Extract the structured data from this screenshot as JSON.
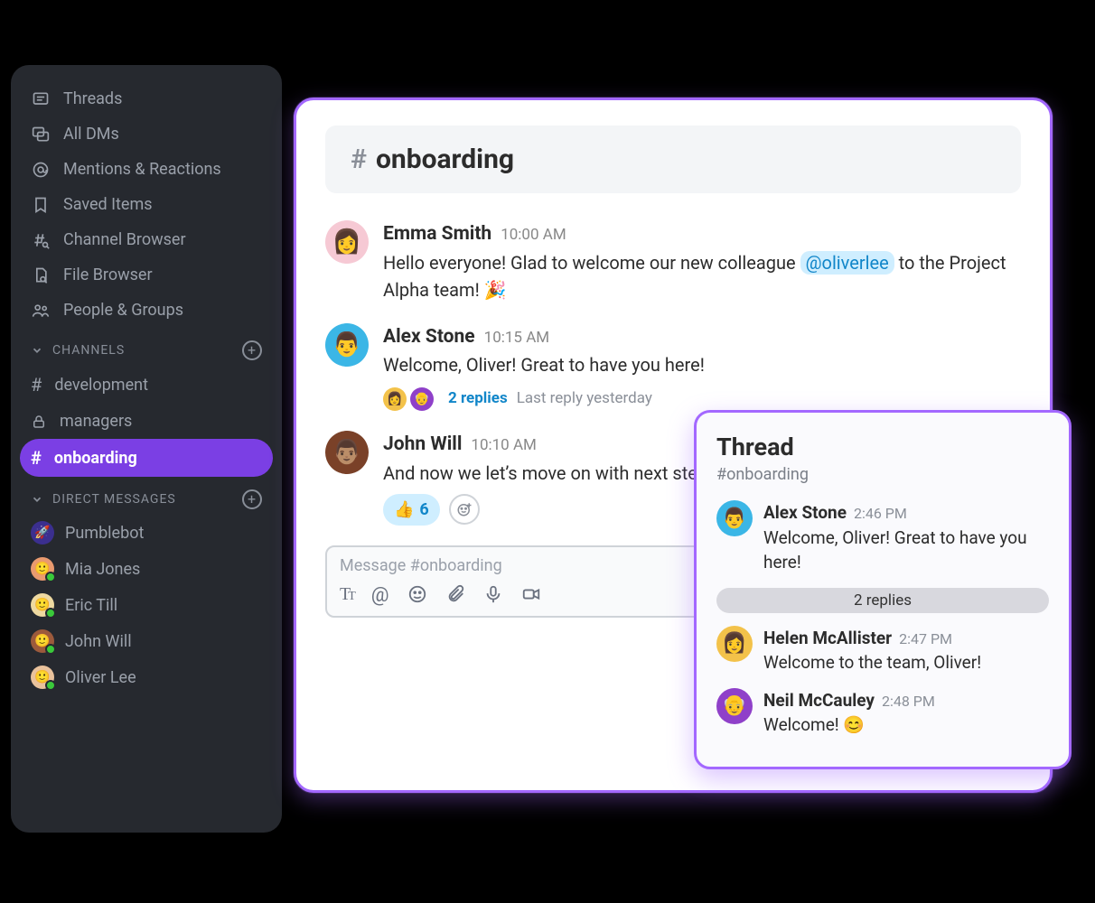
{
  "sidebar": {
    "items": [
      {
        "label": "Threads",
        "icon": "threads-icon"
      },
      {
        "label": "All DMs",
        "icon": "dms-icon"
      },
      {
        "label": "Mentions & Reactions",
        "icon": "mention-icon"
      },
      {
        "label": "Saved Items",
        "icon": "bookmark-icon"
      },
      {
        "label": "Channel Browser",
        "icon": "hash-search-icon"
      },
      {
        "label": "File Browser",
        "icon": "file-search-icon"
      },
      {
        "label": "People & Groups",
        "icon": "people-icon"
      }
    ],
    "channels_header": "CHANNELS",
    "channels": [
      {
        "label": "development",
        "icon": "hash-icon",
        "active": false
      },
      {
        "label": "managers",
        "icon": "lock-icon",
        "active": false
      },
      {
        "label": "onboarding",
        "icon": "hash-icon",
        "active": true
      }
    ],
    "dm_header": "DIRECT MESSAGES",
    "dms": [
      {
        "label": "Pumblebot",
        "presence": false,
        "color": "#3b2f8f"
      },
      {
        "label": "Mia Jones",
        "presence": true,
        "color": "#e99a6f"
      },
      {
        "label": "Eric Till",
        "presence": true,
        "color": "#eed9a1"
      },
      {
        "label": "John Will",
        "presence": true,
        "color": "#9c5a3c"
      },
      {
        "label": "Oliver Lee",
        "presence": true,
        "color": "#e9c29c"
      }
    ]
  },
  "channel": {
    "name": "onboarding",
    "messages": [
      {
        "author": "Emma Smith",
        "time": "10:00 AM",
        "avatar_color": "#f6c9d4",
        "text_before": "Hello everyone! Glad to welcome our new colleague ",
        "mention": "@oliverlee",
        "text_after": " to the Project Alpha team! 🎉"
      },
      {
        "author": "Alex Stone",
        "time": "10:15 AM",
        "avatar_color": "#3bb6e6",
        "text": "Welcome, Oliver! Great to have you here!",
        "thread": {
          "replies_label": "2 replies",
          "last_reply_label": "Last reply yesterday",
          "reply_avatars": [
            "#f3c24a",
            "#8f40c9"
          ]
        }
      },
      {
        "author": "John Will",
        "time": "10:10 AM",
        "avatar_color": "#7a4128",
        "text": "And now we let’s move on with next steps.",
        "reactions": [
          {
            "emoji": "👍",
            "count": "6"
          }
        ]
      }
    ],
    "composer_placeholder": "Message #onboarding"
  },
  "thread": {
    "title": "Thread",
    "channel_label": "#onboarding",
    "root": {
      "author": "Alex Stone",
      "time": "2:46 PM",
      "avatar_color": "#3bb6e6",
      "text": "Welcome, Oliver! Great to have you here!"
    },
    "replies_count_label": "2 replies",
    "replies": [
      {
        "author": "Helen McAllister",
        "time": "2:47 PM",
        "avatar_color": "#f3c24a",
        "text": "Welcome to the team, Oliver!"
      },
      {
        "author": "Neil McCauley",
        "time": "2:48 PM",
        "avatar_color": "#8f40c9",
        "text": "Welcome! 😊"
      }
    ]
  }
}
